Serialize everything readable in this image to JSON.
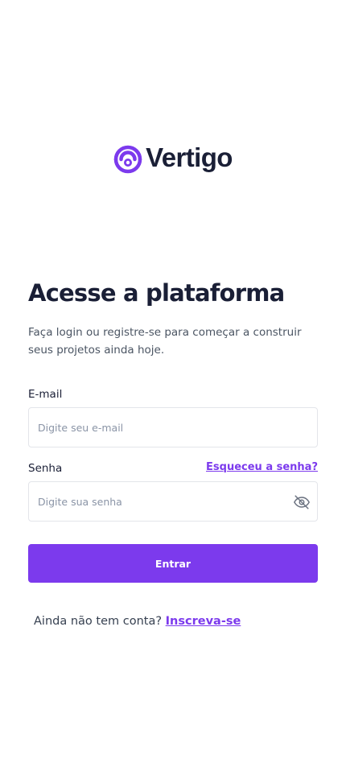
{
  "brand": {
    "name": "Vertigo",
    "logo_icon": "vertigo-logo-icon",
    "accent_color": "#7c3aed",
    "text_color": "#1a1f36"
  },
  "heading": {
    "title": "Acesse a plataforma",
    "subtitle": "Faça login ou registre-se para começar a construir seus projetos ainda hoje."
  },
  "form": {
    "email": {
      "label": "E-mail",
      "placeholder": "Digite seu e-mail",
      "value": ""
    },
    "password": {
      "label": "Senha",
      "placeholder": "Digite sua senha",
      "value": "",
      "toggle_icon": "eye-off-icon"
    },
    "forgot_link": "Esqueceu a senha?",
    "submit_label": "Entrar"
  },
  "signup": {
    "prompt": "Ainda não tem conta?",
    "link": "Inscreva-se"
  }
}
